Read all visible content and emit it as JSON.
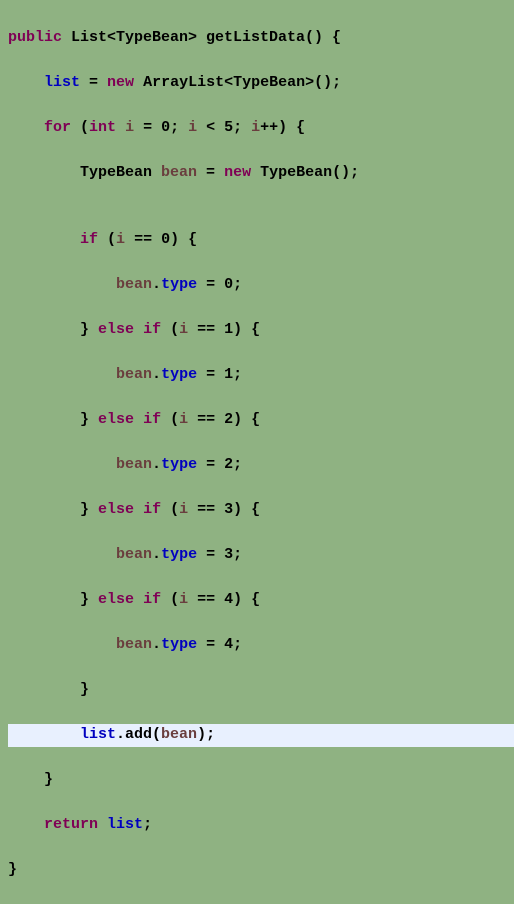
{
  "code": {
    "l1": {
      "kw_public": "public",
      "ret_type": " List<TypeBean> getListData() {"
    },
    "l2": {
      "indent": "    ",
      "fld_list": "list",
      "eq": " = ",
      "kw_new": "new",
      "rest": " ArrayList<TypeBean>();"
    },
    "l3": {
      "indent": "    ",
      "kw_for": "for",
      "p1": " (",
      "kw_int": "int",
      "sp": " ",
      "var_i": "i",
      "mid1": " = 0; ",
      "var_i2": "i",
      "mid2": " < 5; ",
      "var_i3": "i",
      "end": "++) {"
    },
    "l4": {
      "indent": "        ",
      "t1": "TypeBean ",
      "var_bean": "bean",
      "eq": " = ",
      "kw_new": "new",
      "rest": " TypeBean();"
    },
    "l5": {
      "blank": ""
    },
    "l6": {
      "indent": "        ",
      "kw_if": "if",
      "p1": " (",
      "var_i": "i",
      "cond": " == 0) {"
    },
    "l7": {
      "indent": "            ",
      "var_bean": "bean",
      "dot": ".",
      "fld_type": "type",
      "rest": " = 0;"
    },
    "l8": {
      "indent": "        ",
      "brace": "} ",
      "kw_else": "else",
      "sp": " ",
      "kw_if": "if",
      "p1": " (",
      "var_i": "i",
      "cond": " == 1) {"
    },
    "l9": {
      "indent": "            ",
      "var_bean": "bean",
      "dot": ".",
      "fld_type": "type",
      "rest": " = 1;"
    },
    "l10": {
      "indent": "        ",
      "brace": "} ",
      "kw_else": "else",
      "sp": " ",
      "kw_if": "if",
      "p1": " (",
      "var_i": "i",
      "cond": " == 2) {"
    },
    "l11": {
      "indent": "            ",
      "var_bean": "bean",
      "dot": ".",
      "fld_type": "type",
      "rest": " = 2;"
    },
    "l12": {
      "indent": "        ",
      "brace": "} ",
      "kw_else": "else",
      "sp": " ",
      "kw_if": "if",
      "p1": " (",
      "var_i": "i",
      "cond": " == 3) {"
    },
    "l13": {
      "indent": "            ",
      "var_bean": "bean",
      "dot": ".",
      "fld_type": "type",
      "rest": " = 3;"
    },
    "l14": {
      "indent": "        ",
      "brace": "} ",
      "kw_else": "else",
      "sp": " ",
      "kw_if": "if",
      "p1": " (",
      "var_i": "i",
      "cond": " == 4) {"
    },
    "l15": {
      "indent": "            ",
      "var_bean": "bean",
      "dot": ".",
      "fld_type": "type",
      "rest": " = 4;"
    },
    "l16": {
      "indent": "        ",
      "brace": "}"
    },
    "l17": {
      "indent": "        ",
      "fld_list": "list",
      "dot": ".add(",
      "var_bean": "bean",
      "end": ");"
    },
    "l18": {
      "indent": "    ",
      "brace": "}"
    },
    "l19": {
      "indent": "    ",
      "kw_return": "return",
      "sp": " ",
      "fld_list": "list",
      "semi": ";"
    },
    "l20": {
      "brace": "}"
    }
  }
}
